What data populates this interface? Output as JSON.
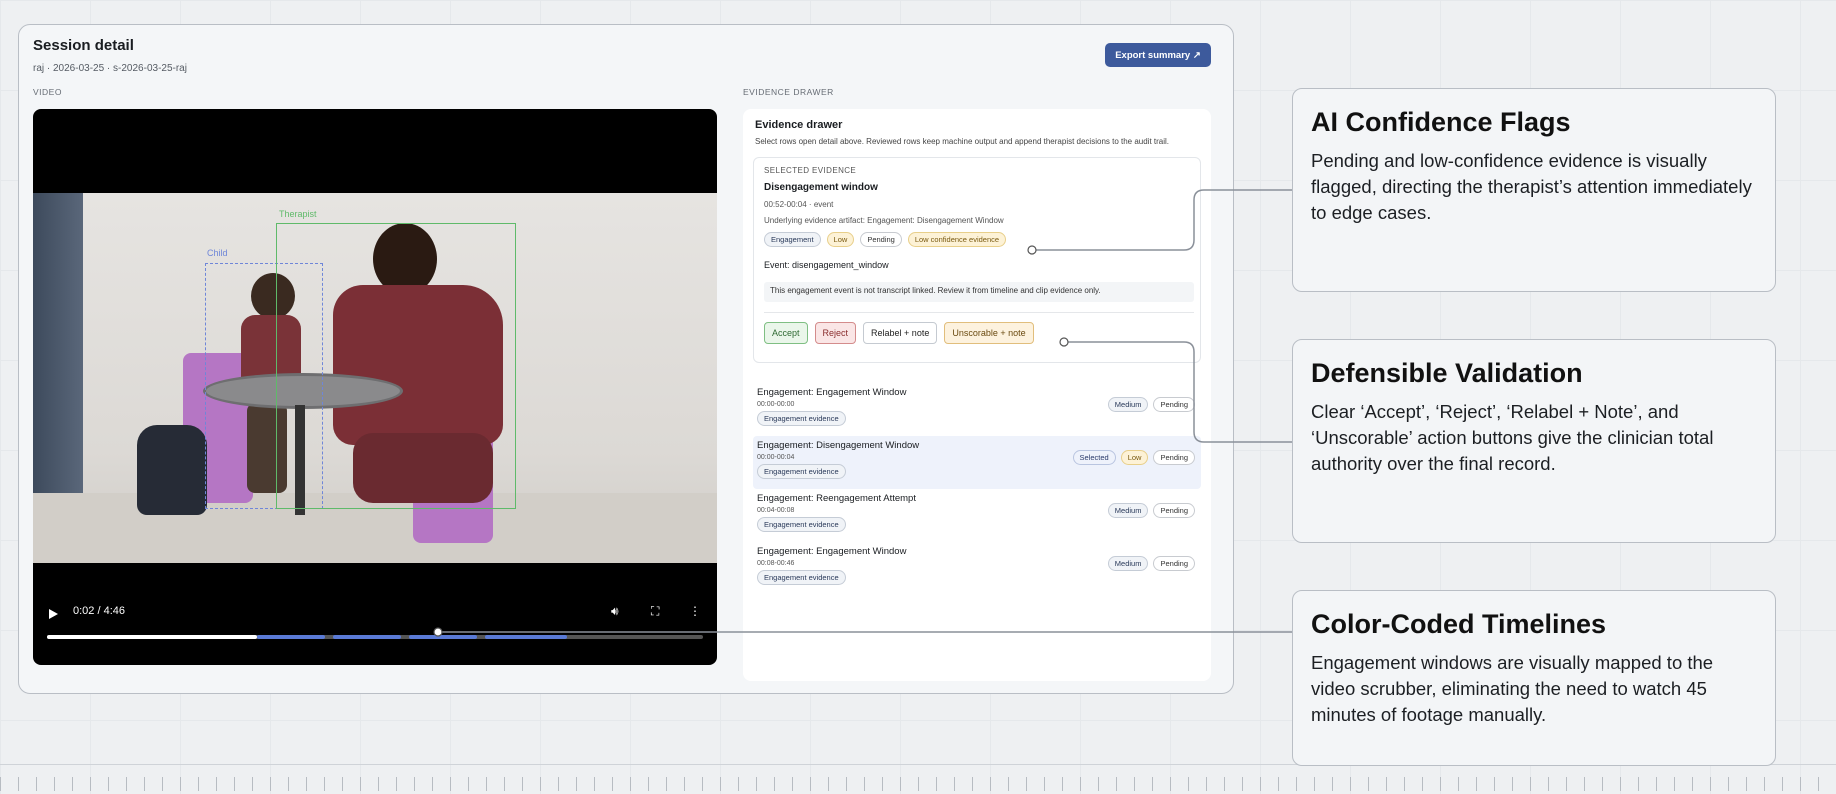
{
  "session": {
    "title": "Session detail",
    "subtitle": "raj · 2026-03-25 · s-2026-03-25-raj",
    "export_label": "Export summary ↗",
    "video_label": "VIDEO",
    "drawer_label": "EVIDENCE DRAWER"
  },
  "video": {
    "box_child_label": "Child",
    "box_therapist_label": "Therapist",
    "time_display": "0:02 / 4:46",
    "progress": 0.32
  },
  "drawer": {
    "title": "Evidence drawer",
    "description": "Select rows open detail above. Reviewed rows keep machine output and append therapist decisions to the audit trail.",
    "selected": {
      "heading": "SELECTED EVIDENCE",
      "title": "Disengagement window",
      "time": "00:52-00:04 · event",
      "context": "Underlying evidence artifact: Engagement: Disengagement Window",
      "tags": [
        "Engagement",
        "Low",
        "Pending",
        "Low confidence evidence"
      ],
      "event": "Event: disengagement_window",
      "note": "This engagement event is not transcript linked. Review it from timeline and clip evidence only.",
      "actions": {
        "accept": "Accept",
        "reject": "Reject",
        "relabel": "Relabel + note",
        "unscorable": "Unscorable + note"
      }
    },
    "rows": [
      {
        "title": "Engagement: Engagement Window",
        "time": "00:00-00:00",
        "tag": "Engagement evidence",
        "badges": [
          "Medium",
          "Pending"
        ]
      },
      {
        "title": "Engagement: Disengagement Window",
        "time": "00:00-00:04",
        "tag": "Engagement evidence",
        "badges": [
          "Selected",
          "Low",
          "Pending"
        ]
      },
      {
        "title": "Engagement: Reengagement Attempt",
        "time": "00:04-00:08",
        "tag": "Engagement evidence",
        "badges": [
          "Medium",
          "Pending"
        ]
      },
      {
        "title": "Engagement: Engagement Window",
        "time": "00:08-00:46",
        "tag": "Engagement evidence",
        "badges": [
          "Medium",
          "Pending"
        ]
      }
    ]
  },
  "callouts": [
    {
      "title": "AI Confidence Flags",
      "body": "Pending and low-confidence evidence is visually flagged, directing the therapist’s attention immediately to edge cases."
    },
    {
      "title": "Defensible Validation",
      "body": "Clear ‘Accept’, ‘Reject’, ‘Relabel + Note’, and ‘Unscorable’ action buttons give the clinician total authority over the final record."
    },
    {
      "title": "Color-Coded Timelines",
      "body": "Engagement windows are visually mapped to the video scrubber, eliminating the need to watch 45 minutes of footage manually."
    }
  ],
  "icons": {
    "play": "play-icon",
    "volume": "volume-icon",
    "fullscreen": "fullscreen-icon",
    "more": "more-vertical-icon"
  }
}
